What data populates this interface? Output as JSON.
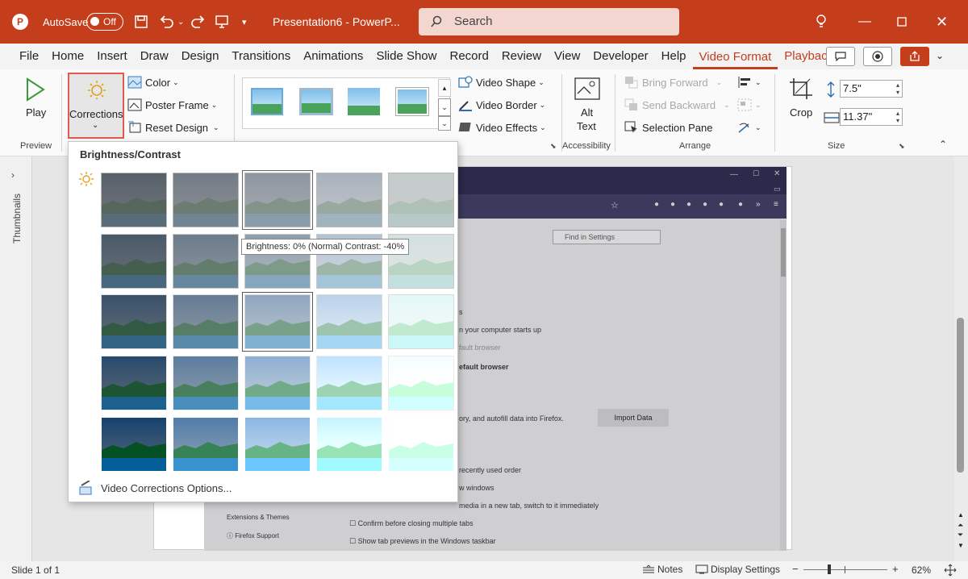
{
  "app": {
    "autosave_label": "AutoSave",
    "autosave_state": "Off",
    "title": "Presentation6  -  PowerP...",
    "search_placeholder": "Search"
  },
  "menu": {
    "items": [
      "File",
      "Home",
      "Insert",
      "Draw",
      "Design",
      "Transitions",
      "Animations",
      "Slide Show",
      "Record",
      "Review",
      "View",
      "Developer",
      "Help"
    ],
    "active": "Video Format",
    "playback": "Playback"
  },
  "ribbon": {
    "play": "Play",
    "preview_group": "Preview",
    "corrections": "Corrections",
    "color": "Color",
    "poster_frame": "Poster Frame",
    "reset_design": "Reset Design",
    "video_shape": "Video Shape",
    "video_border": "Video Border",
    "video_effects": "Video Effects",
    "alt_text_1": "Alt",
    "alt_text_2": "Text",
    "accessibility_group": "Accessibility",
    "bring_forward": "Bring Forward",
    "send_backward": "Send Backward",
    "selection_pane": "Selection Pane",
    "arrange_group": "Arrange",
    "crop": "Crop",
    "height": "7.5\"",
    "width": "11.37\"",
    "size_group": "Size"
  },
  "dropdown": {
    "header": "Brightness/Contrast",
    "tooltip": "Brightness: 0% (Normal) Contrast: -40%",
    "options_label": "Video Corrections Options..."
  },
  "thumbnails_label": "Thumbnails",
  "slide_content": {
    "find_placeholder": "Find in Settings",
    "lines": [
      "s",
      "n your computer starts up",
      "fault browser",
      "efault browser",
      "ory, and autofill data into Firefox.",
      "recently used order",
      "w windows",
      "media in a new tab, switch to it immediately",
      "Confirm before closing multiple tabs",
      "Show tab previews in the Windows taskbar"
    ],
    "import_button": "Import Data",
    "sidebar_items": [
      "Extensions & Themes",
      "Firefox Support"
    ]
  },
  "status": {
    "slide": "Slide 1 of 1",
    "notes": "Notes",
    "display_settings": "Display Settings",
    "zoom": "62%"
  },
  "colors": {
    "accent": "#c43e1c",
    "highlight_box": "#e05a4e"
  }
}
